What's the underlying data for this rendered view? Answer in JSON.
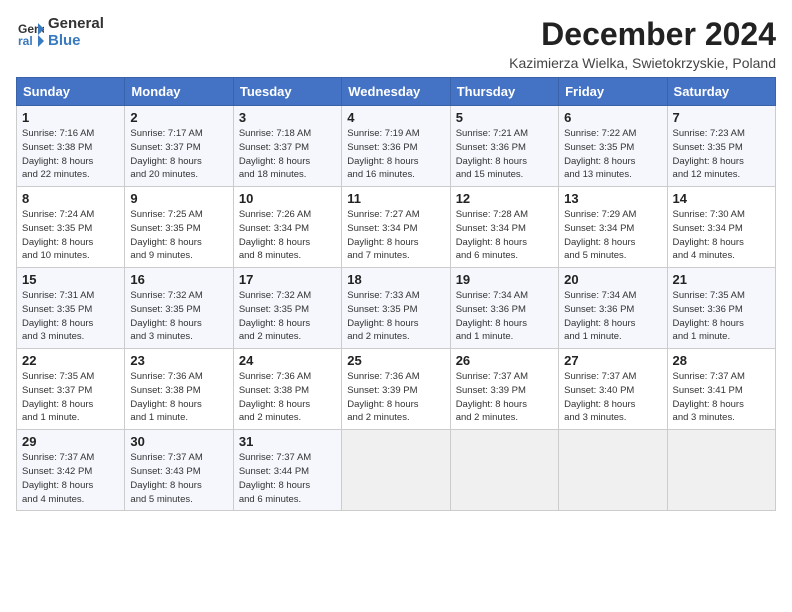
{
  "header": {
    "logo_line1": "General",
    "logo_line2": "Blue",
    "month_title": "December 2024",
    "location": "Kazimierza Wielka, Swietokrzyskie, Poland"
  },
  "weekdays": [
    "Sunday",
    "Monday",
    "Tuesday",
    "Wednesday",
    "Thursday",
    "Friday",
    "Saturday"
  ],
  "weeks": [
    [
      {
        "day": "1",
        "info": "Sunrise: 7:16 AM\nSunset: 3:38 PM\nDaylight: 8 hours\nand 22 minutes."
      },
      {
        "day": "2",
        "info": "Sunrise: 7:17 AM\nSunset: 3:37 PM\nDaylight: 8 hours\nand 20 minutes."
      },
      {
        "day": "3",
        "info": "Sunrise: 7:18 AM\nSunset: 3:37 PM\nDaylight: 8 hours\nand 18 minutes."
      },
      {
        "day": "4",
        "info": "Sunrise: 7:19 AM\nSunset: 3:36 PM\nDaylight: 8 hours\nand 16 minutes."
      },
      {
        "day": "5",
        "info": "Sunrise: 7:21 AM\nSunset: 3:36 PM\nDaylight: 8 hours\nand 15 minutes."
      },
      {
        "day": "6",
        "info": "Sunrise: 7:22 AM\nSunset: 3:35 PM\nDaylight: 8 hours\nand 13 minutes."
      },
      {
        "day": "7",
        "info": "Sunrise: 7:23 AM\nSunset: 3:35 PM\nDaylight: 8 hours\nand 12 minutes."
      }
    ],
    [
      {
        "day": "8",
        "info": "Sunrise: 7:24 AM\nSunset: 3:35 PM\nDaylight: 8 hours\nand 10 minutes."
      },
      {
        "day": "9",
        "info": "Sunrise: 7:25 AM\nSunset: 3:35 PM\nDaylight: 8 hours\nand 9 minutes."
      },
      {
        "day": "10",
        "info": "Sunrise: 7:26 AM\nSunset: 3:34 PM\nDaylight: 8 hours\nand 8 minutes."
      },
      {
        "day": "11",
        "info": "Sunrise: 7:27 AM\nSunset: 3:34 PM\nDaylight: 8 hours\nand 7 minutes."
      },
      {
        "day": "12",
        "info": "Sunrise: 7:28 AM\nSunset: 3:34 PM\nDaylight: 8 hours\nand 6 minutes."
      },
      {
        "day": "13",
        "info": "Sunrise: 7:29 AM\nSunset: 3:34 PM\nDaylight: 8 hours\nand 5 minutes."
      },
      {
        "day": "14",
        "info": "Sunrise: 7:30 AM\nSunset: 3:34 PM\nDaylight: 8 hours\nand 4 minutes."
      }
    ],
    [
      {
        "day": "15",
        "info": "Sunrise: 7:31 AM\nSunset: 3:35 PM\nDaylight: 8 hours\nand 3 minutes."
      },
      {
        "day": "16",
        "info": "Sunrise: 7:32 AM\nSunset: 3:35 PM\nDaylight: 8 hours\nand 3 minutes."
      },
      {
        "day": "17",
        "info": "Sunrise: 7:32 AM\nSunset: 3:35 PM\nDaylight: 8 hours\nand 2 minutes."
      },
      {
        "day": "18",
        "info": "Sunrise: 7:33 AM\nSunset: 3:35 PM\nDaylight: 8 hours\nand 2 minutes."
      },
      {
        "day": "19",
        "info": "Sunrise: 7:34 AM\nSunset: 3:36 PM\nDaylight: 8 hours\nand 1 minute."
      },
      {
        "day": "20",
        "info": "Sunrise: 7:34 AM\nSunset: 3:36 PM\nDaylight: 8 hours\nand 1 minute."
      },
      {
        "day": "21",
        "info": "Sunrise: 7:35 AM\nSunset: 3:36 PM\nDaylight: 8 hours\nand 1 minute."
      }
    ],
    [
      {
        "day": "22",
        "info": "Sunrise: 7:35 AM\nSunset: 3:37 PM\nDaylight: 8 hours\nand 1 minute."
      },
      {
        "day": "23",
        "info": "Sunrise: 7:36 AM\nSunset: 3:38 PM\nDaylight: 8 hours\nand 1 minute."
      },
      {
        "day": "24",
        "info": "Sunrise: 7:36 AM\nSunset: 3:38 PM\nDaylight: 8 hours\nand 2 minutes."
      },
      {
        "day": "25",
        "info": "Sunrise: 7:36 AM\nSunset: 3:39 PM\nDaylight: 8 hours\nand 2 minutes."
      },
      {
        "day": "26",
        "info": "Sunrise: 7:37 AM\nSunset: 3:39 PM\nDaylight: 8 hours\nand 2 minutes."
      },
      {
        "day": "27",
        "info": "Sunrise: 7:37 AM\nSunset: 3:40 PM\nDaylight: 8 hours\nand 3 minutes."
      },
      {
        "day": "28",
        "info": "Sunrise: 7:37 AM\nSunset: 3:41 PM\nDaylight: 8 hours\nand 3 minutes."
      }
    ],
    [
      {
        "day": "29",
        "info": "Sunrise: 7:37 AM\nSunset: 3:42 PM\nDaylight: 8 hours\nand 4 minutes."
      },
      {
        "day": "30",
        "info": "Sunrise: 7:37 AM\nSunset: 3:43 PM\nDaylight: 8 hours\nand 5 minutes."
      },
      {
        "day": "31",
        "info": "Sunrise: 7:37 AM\nSunset: 3:44 PM\nDaylight: 8 hours\nand 6 minutes."
      },
      null,
      null,
      null,
      null
    ]
  ]
}
